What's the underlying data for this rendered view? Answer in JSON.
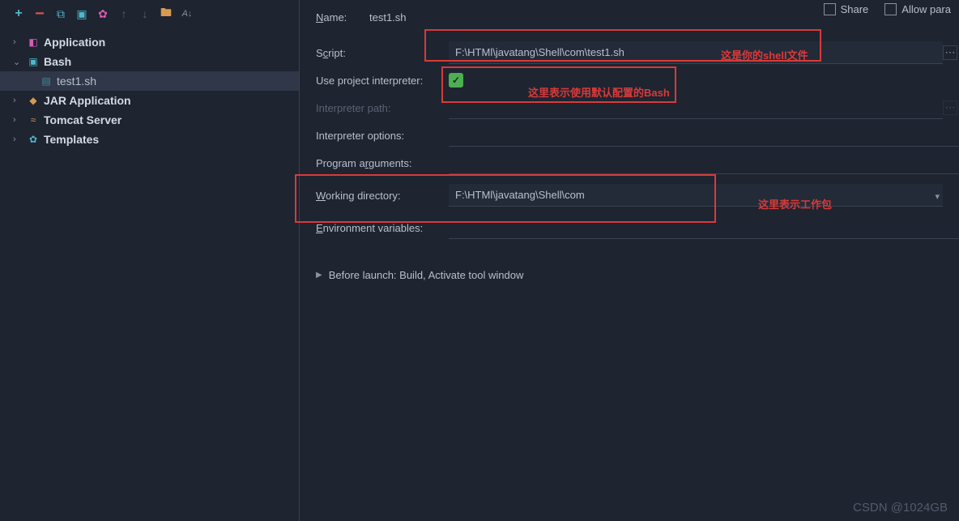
{
  "toolbar_hints": {
    "add": "+",
    "remove": "−",
    "copy": "⧉",
    "save": "💾",
    "gear": "⚙",
    "up": "↑",
    "down": "↓",
    "folder": "🗀",
    "sort": "A↓Z"
  },
  "tree": {
    "application": "Application",
    "bash": "Bash",
    "file": "test1.sh",
    "jar": "JAR Application",
    "tomcat": "Tomcat Server",
    "templates": "Templates"
  },
  "labels": {
    "name": "Name:",
    "script": "Script:",
    "use_interpreter": "Use project interpreter:",
    "interpreter_path": "Interpreter path:",
    "interpreter_options": "Interpreter options:",
    "program_arguments": "Program arguments:",
    "working_directory": "Working directory:",
    "environment_variables": "Environment variables:",
    "before_launch": "Before launch: Build, Activate tool window",
    "share": "Share",
    "allow_parallel": "Allow para"
  },
  "values": {
    "name": "test1.sh",
    "script": "F:\\HTMl\\javatang\\Shell\\com\\test1.sh",
    "working_directory": "F:\\HTMl\\javatang\\Shell\\com"
  },
  "annotations": {
    "a1": "这是你的shell文件",
    "a2": "这里表示使用默认配置的Bash",
    "a3": "这里表示工作包"
  },
  "watermark": "CSDN @1024GB"
}
